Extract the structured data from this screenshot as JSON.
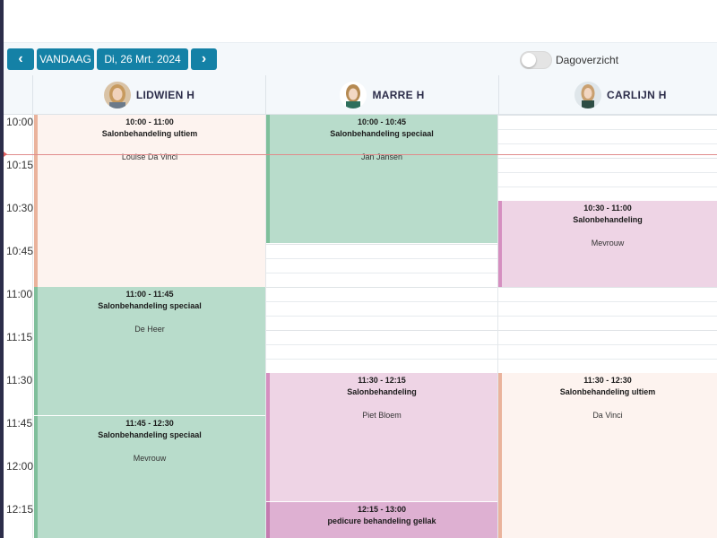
{
  "toolbar": {
    "prev_icon": "chevron-left-icon",
    "prev_glyph": "‹",
    "today_label": "VANDAAG",
    "date_label": "Di, 26 Mrt. 2024",
    "next_icon": "chevron-right-icon",
    "next_glyph": "›",
    "day_view_label": "Dagoverzicht",
    "day_view_enabled": false
  },
  "colors": {
    "accent": "#1481a6",
    "green_bg": "#b8dccb",
    "green_bar": "#7fbf9b",
    "peach_bg": "#fdf3ef",
    "peach_bar": "#eab39c",
    "pink_bg": "#eed4e5",
    "pink_bar": "#d58fc0",
    "pink_dark_bg": "#deb0d2",
    "now_line": "#e08b8b"
  },
  "staff": [
    {
      "name": "LIDWIEN H",
      "avatar_icon": "avatar-lidwien"
    },
    {
      "name": "MARRE H",
      "avatar_icon": "avatar-marre"
    },
    {
      "name": "CARLIJN H",
      "avatar_icon": "avatar-carlijn"
    }
  ],
  "times": [
    "10:00",
    "10:15",
    "10:30",
    "10:45",
    "11:00",
    "11:15",
    "11:30",
    "11:45",
    "12:00",
    "12:15"
  ],
  "appointments": [
    {
      "time": "10:00 - 11:00",
      "title": "Salonbehandeling ultiem",
      "client": "Louise Da Vinci"
    },
    {
      "time": "11:00 - 11:45",
      "title": "Salonbehandeling speciaal",
      "client": "De Heer"
    },
    {
      "time": "11:45 - 12:30",
      "title": "Salonbehandeling speciaal",
      "client": "Mevrouw"
    },
    {
      "time": "10:00 - 10:45",
      "title": "Salonbehandeling speciaal",
      "client": "Jan Jansen"
    },
    {
      "time": "11:30 - 12:15",
      "title": "Salonbehandeling",
      "client": "Piet Bloem"
    },
    {
      "time": "12:15 - 13:00",
      "title": "pedicure behandeling gellak",
      "client": ""
    },
    {
      "time": "10:30 - 11:00",
      "title": "Salonbehandeling",
      "client": "Mevrouw"
    },
    {
      "time": "11:30 - 12:30",
      "title": "Salonbehandeling ultiem",
      "client": "Da Vinci"
    }
  ]
}
